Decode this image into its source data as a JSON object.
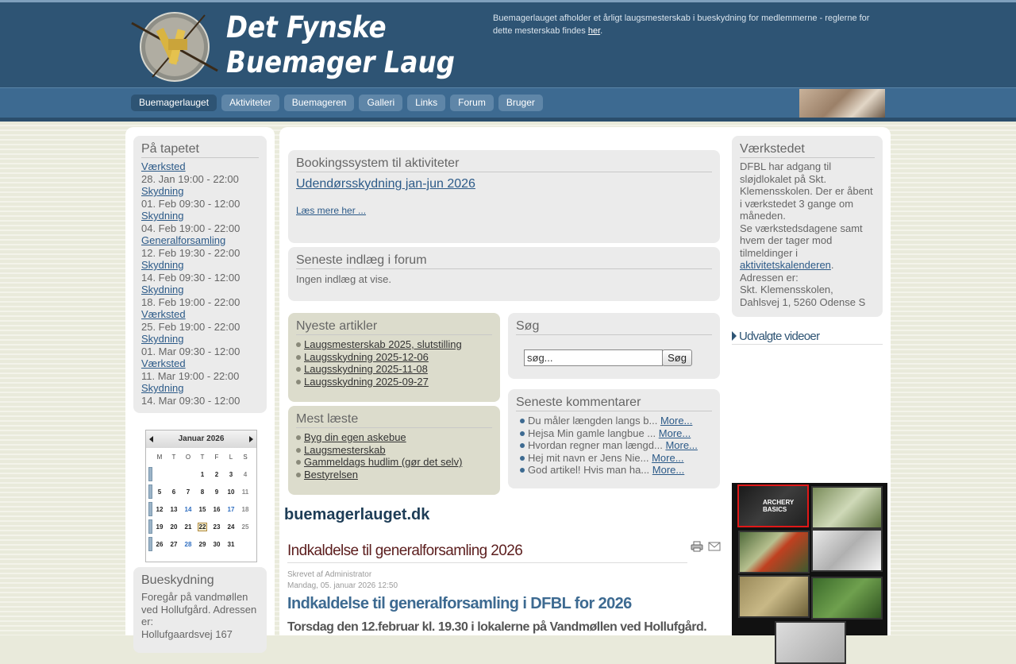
{
  "header": {
    "logo_line1": "Det Fynske",
    "logo_line2": "Buemager Laug",
    "note_text": "Buemagerlauget afholder et årligt laugsmesterskab i bueskydning for medlemmerne - reglerne for dette mesterskab findes ",
    "note_link": "her",
    "note_end": "."
  },
  "nav": [
    "Buemagerlauget",
    "Aktiviteter",
    "Buemageren",
    "Galleri",
    "Links",
    "Forum",
    "Bruger"
  ],
  "tapetet": {
    "title": "På tapetet",
    "events": [
      {
        "name": "Værksted",
        "time": "28. Jan 19:00 - 22:00"
      },
      {
        "name": "Skydning",
        "time": "01. Feb 09:30 - 12:00"
      },
      {
        "name": "Skydning",
        "time": "04. Feb 19:00 - 22:00"
      },
      {
        "name": "Generalforsamling",
        "time": "12. Feb 19:30 - 22:00"
      },
      {
        "name": "Skydning",
        "time": "14. Feb 09:30 - 12:00"
      },
      {
        "name": "Skydning",
        "time": "18. Feb 19:00 - 22:00"
      },
      {
        "name": "Værksted",
        "time": "25. Feb 19:00 - 22:00"
      },
      {
        "name": "Skydning",
        "time": "01. Mar 09:30 - 12:00"
      },
      {
        "name": "Værksted",
        "time": "11. Mar 19:00 - 22:00"
      },
      {
        "name": "Skydning",
        "time": "14. Mar 09:30 - 12:00"
      }
    ]
  },
  "calendar": {
    "month": "Januar 2026",
    "days": [
      "M",
      "T",
      "O",
      "T",
      "F",
      "L",
      "S"
    ],
    "weeks": [
      [
        "",
        "",
        "",
        "1",
        "2",
        "3",
        "4"
      ],
      [
        "5",
        "6",
        "7",
        "8",
        "9",
        "10",
        "11"
      ],
      [
        "12",
        "13",
        "14",
        "15",
        "16",
        "17",
        "18"
      ],
      [
        "19",
        "20",
        "21",
        "22",
        "23",
        "24",
        "25"
      ],
      [
        "26",
        "27",
        "28",
        "29",
        "30",
        "31",
        ""
      ]
    ],
    "event_days": [
      "14",
      "17",
      "28"
    ],
    "today": "22"
  },
  "bueskydning": {
    "title": "Bueskydning",
    "text": "Foregår på vandmøllen ved Hollufgård. Adressen er:",
    "address": "Hollufgaardsvej 167"
  },
  "booking": {
    "title": "Bookingssystem til aktiviteter",
    "link": "Udendørsskydning jan-jun 2026",
    "more": "Læs mere her ..."
  },
  "forum": {
    "title": "Seneste indlæg i forum",
    "text": "Ingen indlæg at vise."
  },
  "nyeste": {
    "title": "Nyeste artikler",
    "items": [
      "Laugsmesterskab 2025, slutstilling",
      "Laugsskydning 2025-12-06",
      "Laugsskydning 2025-11-08",
      "Laugsskydning 2025-09-27"
    ]
  },
  "mest": {
    "title": "Mest læste",
    "items": [
      "Byg din egen askebue",
      "Laugsmesterskab",
      "Gammeldags hudlim (gør det selv)",
      "Bestyrelsen"
    ]
  },
  "search": {
    "title": "Søg",
    "value": "søg...",
    "button": "Søg"
  },
  "comments": {
    "title": "Seneste kommentarer",
    "more": "More...",
    "items": [
      "Du måler længden langs b...",
      "Hejsa Min gamle langbue ...",
      "Hvordan regner man længd...",
      "Hej mit navn er Jens Nie...",
      "God artikel! Hvis man ha..."
    ]
  },
  "site_title": "buemagerlauget.dk",
  "article": {
    "title": "Indkaldelse til generalforsamling 2026",
    "author": "Skrevet af Administrator",
    "date": "Mandag, 05. januar 2026 12:50",
    "subtitle": "Indkaldelse til generalforsamling i DFBL for 2026",
    "line": "Torsdag den 12.februar kl. 19.30 i lokalerne på Vandmøllen ved Hollufgård."
  },
  "vaerkstedet": {
    "title": "Værkstedet",
    "text1": "DFBL har adgang til sløjdlokalet på Skt. Klemensskolen. Der er åbent i værkstedet 3 gange om måneden.",
    "text2": "Se værkstedsdagene samt hvem der tager mod tilmeldinger i ",
    "link": "aktivitetskalenderen",
    "text2_end": ".",
    "text3": "Adressen er:",
    "text4": "Skt. Klemensskolen, Dahlsvej 1, 5260 Odense S"
  },
  "videos": {
    "title": "Udvalgte videoer",
    "thumb1_caption": "ARCHERY BASICS"
  }
}
